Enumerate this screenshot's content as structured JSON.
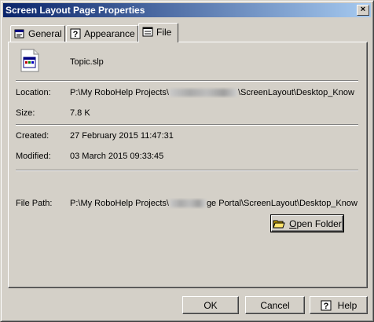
{
  "window": {
    "title": "Screen Layout Page Properties",
    "close_glyph": "×"
  },
  "tabs": [
    {
      "label": "General",
      "icon": "properties-icon"
    },
    {
      "label": "Appearance",
      "icon": "help-question-icon"
    },
    {
      "label": "File",
      "icon": "file-tab-icon",
      "active": true
    }
  ],
  "file": {
    "name": "Topic.slp",
    "icon": "screen-layout-file-icon",
    "location_label": "Location:",
    "location_prefix": "P:\\My RoboHelp Projects\\",
    "location_suffix": "\\ScreenLayout\\Desktop_Know",
    "size_label": "Size:",
    "size_value": "7.8 K",
    "created_label": "Created:",
    "created_value": "27 February 2015 11:47:31",
    "modified_label": "Modified:",
    "modified_value": "03 March 2015 09:33:45",
    "path_label": "File Path:",
    "path_prefix": "P:\\My RoboHelp Projects\\",
    "path_suffix": "ge Portal\\ScreenLayout\\Desktop_Know"
  },
  "open_folder": {
    "label_accel": "O",
    "label_rest": "pen Folder",
    "icon": "open-folder-icon"
  },
  "buttons": {
    "ok": "OK",
    "cancel": "Cancel",
    "help": "Help",
    "help_icon": "help-question-icon"
  }
}
